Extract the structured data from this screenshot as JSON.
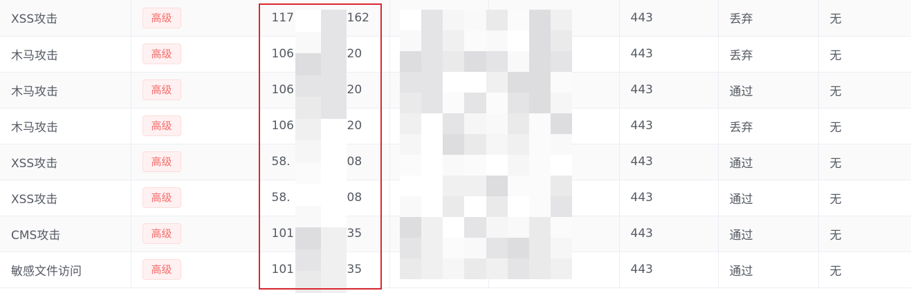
{
  "colors": {
    "tag_text": "#f56c6c",
    "tag_bg": "#fff1f1",
    "tag_border": "#fcdcdc",
    "highlight": "#d9262c",
    "row_stripe": "#fafafa",
    "text": "#555a63"
  },
  "rows": [
    {
      "attack_type": "XSS攻击",
      "level": "高级",
      "src_ip_head": "117",
      "src_ip_tail": "162",
      "port": "443",
      "action": "丢弃",
      "extra": "无"
    },
    {
      "attack_type": "木马攻击",
      "level": "高级",
      "src_ip_head": "106",
      "src_ip_tail": "20",
      "port": "443",
      "action": "丢弃",
      "extra": "无"
    },
    {
      "attack_type": "木马攻击",
      "level": "高级",
      "src_ip_head": "106",
      "src_ip_tail": "20",
      "port": "443",
      "action": "通过",
      "extra": "无"
    },
    {
      "attack_type": "木马攻击",
      "level": "高级",
      "src_ip_head": "106",
      "src_ip_tail": "20",
      "port": "443",
      "action": "丢弃",
      "extra": "无"
    },
    {
      "attack_type": "XSS攻击",
      "level": "高级",
      "src_ip_head": "58.",
      "src_ip_tail": "08",
      "port": "443",
      "action": "通过",
      "extra": "无"
    },
    {
      "attack_type": "XSS攻击",
      "level": "高级",
      "src_ip_head": "58.",
      "src_ip_tail": "08",
      "port": "443",
      "action": "通过",
      "extra": "无"
    },
    {
      "attack_type": "CMS攻击",
      "level": "高级",
      "src_ip_head": "101",
      "src_ip_tail": "35",
      "port": "443",
      "action": "通过",
      "extra": "无"
    },
    {
      "attack_type": "敏感文件访问",
      "level": "高级",
      "src_ip_head": "101",
      "src_ip_tail": "35",
      "port": "443",
      "action": "通过",
      "extra": "无"
    }
  ]
}
